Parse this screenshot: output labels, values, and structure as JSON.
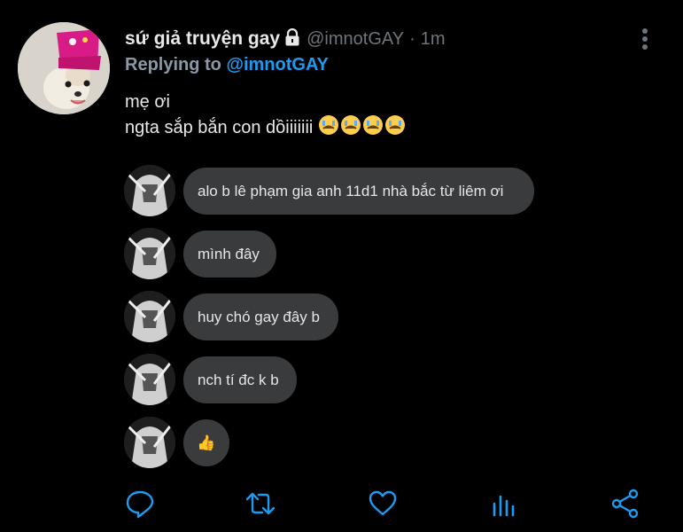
{
  "tweet": {
    "display_name": "sứ giả truyện gay",
    "handle": "@imnotGAY",
    "separator": "·",
    "time": "1m",
    "reply_prefix": "Replying to",
    "reply_handle": "@imnotGAY",
    "text_line1": "mẹ ơi",
    "text_line2": "ngta sắp bắn con dồiiiiiii"
  },
  "chat": {
    "messages": [
      {
        "text": "alo b lê phạm gia anh 11d1 nhà bắc từ liêm ơi"
      },
      {
        "text": "mình đây"
      },
      {
        "text": "huy chó gay đây b"
      },
      {
        "text": "nch tí đc k b"
      },
      {
        "text": "👍"
      }
    ]
  },
  "icons": {
    "lock": "lock-icon",
    "more": "more-vertical-icon",
    "reply": "reply-icon",
    "retweet": "retweet-icon",
    "like": "heart-icon",
    "analytics": "analytics-icon",
    "share": "share-icon"
  },
  "colors": {
    "background": "#000000",
    "muted": "#6e767d",
    "link": "#1d9bf0",
    "bubble": "#3a3b3c",
    "action_icon": "#1d9bf0"
  }
}
